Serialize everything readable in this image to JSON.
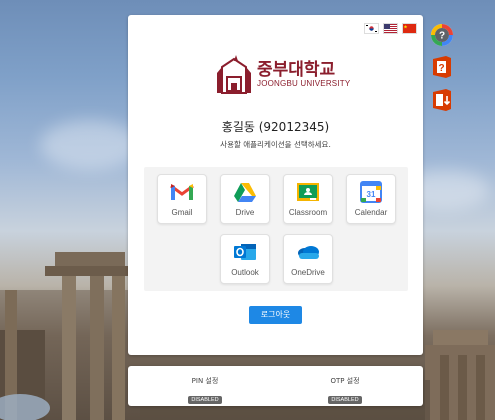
{
  "user": {
    "display": "홍길동  (92012345)"
  },
  "subtitle": "사용할 애플리케이션을 선택하세요.",
  "logo": {
    "ko": "중부대학교",
    "en": "JOONGBU UNIVERSITY"
  },
  "languages": [
    {
      "name": "korean-flag-icon"
    },
    {
      "name": "us-flag-icon"
    },
    {
      "name": "china-flag-icon"
    }
  ],
  "apps": [
    {
      "label": "Gmail",
      "icon": "gmail-icon"
    },
    {
      "label": "Drive",
      "icon": "google-drive-icon"
    },
    {
      "label": "Classroom",
      "icon": "google-classroom-icon"
    },
    {
      "label": "Calendar",
      "icon": "google-calendar-icon"
    },
    {
      "label": "Outlook",
      "icon": "outlook-icon"
    },
    {
      "label": "OneDrive",
      "icon": "onedrive-icon"
    }
  ],
  "logout_label": "로그아웃",
  "settings": {
    "pin": {
      "label": "PIN 설정",
      "status": "DISABLED"
    },
    "otp": {
      "label": "OTP 설정",
      "status": "DISABLED"
    }
  },
  "side_icons": [
    "google-help-icon",
    "office-help-icon",
    "office-download-icon"
  ],
  "colors": {
    "brand": "#8b1e2d",
    "accent": "#1e88e5"
  }
}
